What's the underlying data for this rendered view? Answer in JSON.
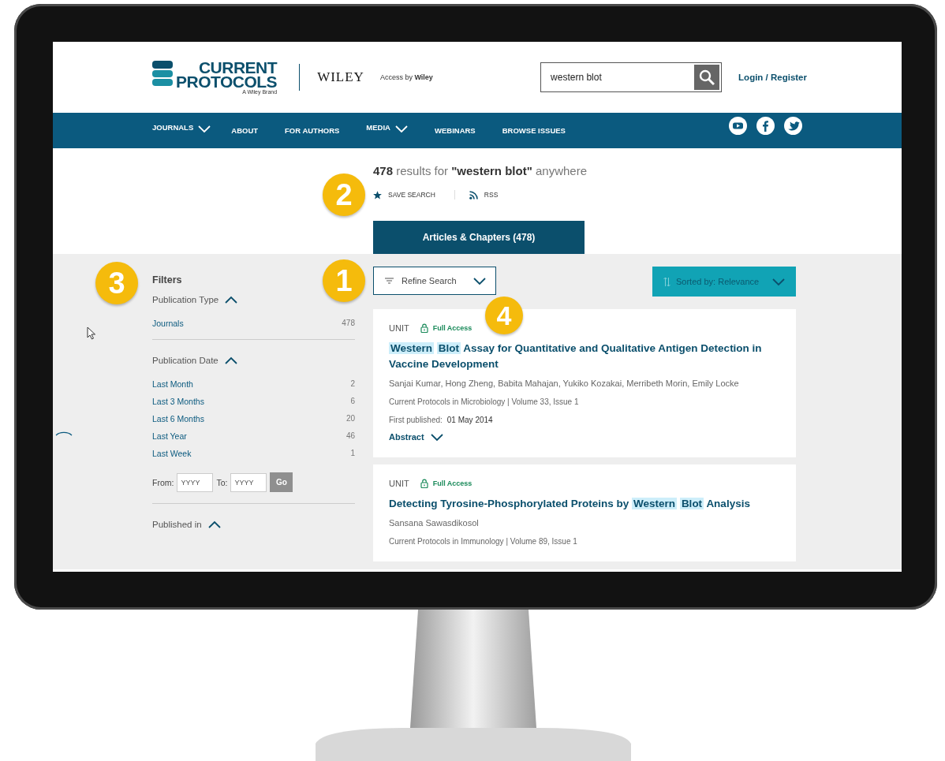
{
  "header": {
    "logo": {
      "line1": "CURRENT",
      "line2": "PROTOCOLS",
      "tagline": "A Wiley Brand"
    },
    "publisher": "WILEY",
    "access": {
      "prefix": "Access by",
      "name": "Wiley"
    },
    "search": {
      "value": "western blot"
    },
    "login": "Login / Register"
  },
  "nav": {
    "items": [
      {
        "label": "JOURNALS",
        "dropdown": true
      },
      {
        "label": "ABOUT",
        "dropdown": false
      },
      {
        "label": "FOR AUTHORS",
        "dropdown": false
      },
      {
        "label": "MEDIA",
        "dropdown": true
      },
      {
        "label": "WEBINARS",
        "dropdown": false
      },
      {
        "label": "BROWSE ISSUES",
        "dropdown": false
      }
    ]
  },
  "results": {
    "count": "478",
    "text": "results for",
    "query": "\"western blot\"",
    "scope": "anywhere",
    "callout": "2",
    "actions": [
      {
        "label": "SAVE SEARCH",
        "kind": "star"
      },
      {
        "label": "RSS",
        "kind": "rss"
      }
    ]
  },
  "tabs": [
    {
      "label": "Articles & Chapters (478)",
      "selected": true
    }
  ],
  "refine": {
    "label": "Refine Search",
    "callout": "1"
  },
  "sort": {
    "label": "Sorted by: Relevance"
  },
  "filters": {
    "title": "Filters",
    "callout": "3",
    "groups": [
      {
        "title": "Publication Type",
        "expanded": true,
        "items": [
          {
            "label": "Journals",
            "count": "478"
          }
        ]
      },
      {
        "title": "Publication Date",
        "expanded": true,
        "items": [
          {
            "label": "Last Month",
            "count": "2"
          },
          {
            "label": "Last 3 Months",
            "count": "6"
          },
          {
            "label": "Last 6 Months",
            "count": "20"
          },
          {
            "label": "Last Year",
            "count": "46"
          },
          {
            "label": "Last Week",
            "count": "1"
          }
        ],
        "range": {
          "from_label": "From:",
          "from_placeholder": "YYYY",
          "to_label": "To:",
          "to_placeholder": "YYYY",
          "button": "Go"
        }
      },
      {
        "title": "Published in",
        "expanded": true
      }
    ]
  },
  "items": [
    {
      "type": "UNIT",
      "access": "Full Access",
      "callout": "4",
      "title": [
        {
          "text": "Western",
          "highlight": true
        },
        {
          "text": "Blot",
          "highlight": true
        },
        {
          "text": "Assay for Quantitative and Qualitative Antigen Detection in Vaccine Development",
          "highlight": false
        }
      ],
      "authors": "Sanjai Kumar, Hong Zheng, Babita Mahajan, Yukiko Kozakai, Merribeth Morin, Emily Locke",
      "source": "Current Protocols in Microbiology | Volume 33, Issue 1",
      "published_label": "First published:",
      "published_date": "01 May 2014",
      "abstract": "Abstract"
    },
    {
      "type": "UNIT",
      "access": "Full Access",
      "title": [
        {
          "text": "Detecting Tyrosine-Phosphorylated Proteins by",
          "highlight": false
        },
        {
          "text": "Western",
          "highlight": true
        },
        {
          "text": "Blot",
          "highlight": true
        },
        {
          "text": "Analysis",
          "highlight": false
        }
      ],
      "authors": "Sansana Sawasdikosol",
      "source": "Current Protocols in Immunology | Volume 89, Issue 1"
    }
  ]
}
